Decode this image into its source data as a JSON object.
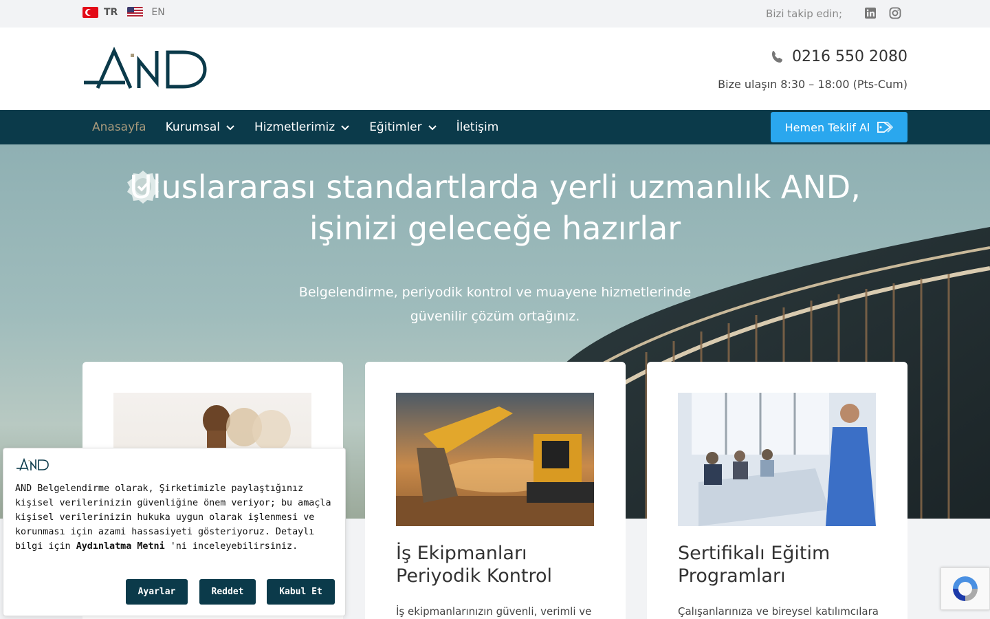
{
  "topbar": {
    "languages": [
      {
        "code": "TR",
        "flag": "turkey-flag"
      },
      {
        "code": "EN",
        "flag": "us-flag"
      }
    ],
    "follow_label": "Bizi takip edin;",
    "social": [
      "linkedin-icon",
      "instagram-icon"
    ]
  },
  "header": {
    "logo_text": "AND",
    "phone": "0216 550 2080",
    "hours": "Bize ulaşın 8:30 – 18:00 (Pts-Cum)"
  },
  "nav": {
    "items": [
      {
        "label": "Anasayfa",
        "active": true,
        "dropdown": false
      },
      {
        "label": "Kurumsal",
        "active": false,
        "dropdown": true
      },
      {
        "label": "Hizmetlerimiz",
        "active": false,
        "dropdown": true
      },
      {
        "label": "Eğitimler",
        "active": false,
        "dropdown": true
      },
      {
        "label": "İletişim",
        "active": false,
        "dropdown": false
      }
    ],
    "cta": "Hemen Teklif Al"
  },
  "hero": {
    "title_line1": "Uluslararası standartlarda yerli uzmanlık AND,",
    "title_line2": "işinizi geleceğe hazırlar",
    "subtitle_line1": "Belgelendirme, periyodik kontrol ve muayene hizmetlerinde",
    "subtitle_line2": "güvenilir çözüm ortağınız."
  },
  "cards": [
    {
      "title": "",
      "text": ""
    },
    {
      "title_line1": "İş Ekipmanları",
      "title_line2": "Periyodik Kontrol",
      "text": "İş ekipmanlarınızın güvenli, verimli ve"
    },
    {
      "title_line1": "Sertifikalı Eğitim",
      "title_line2": "Programları",
      "text": "Çalışanlarınıza ve bireysel katılımcılara"
    }
  ],
  "cookie": {
    "logo_text": "AND",
    "text_before": "AND Belgelendirme olarak, Şirketimizle paylaştığınız kişisel verilerinizin güvenliğine önem veriyor; bu amaçla kişisel verilerinizin hukuka uygun olarak işlenmesi ve korunması için azami hassasiyeti gösteriyoruz. Detaylı bilgi için ",
    "link": "Aydınlatma Metni",
    "text_after": " 'ni inceleyebilirsiniz.",
    "buttons": {
      "settings": "Ayarlar",
      "reject": "Reddet",
      "accept": "Kabul Et"
    }
  },
  "colors": {
    "navy": "#0b3a4a",
    "accent_gold": "#a89a7c",
    "cta_blue": "#2aa7ee"
  }
}
